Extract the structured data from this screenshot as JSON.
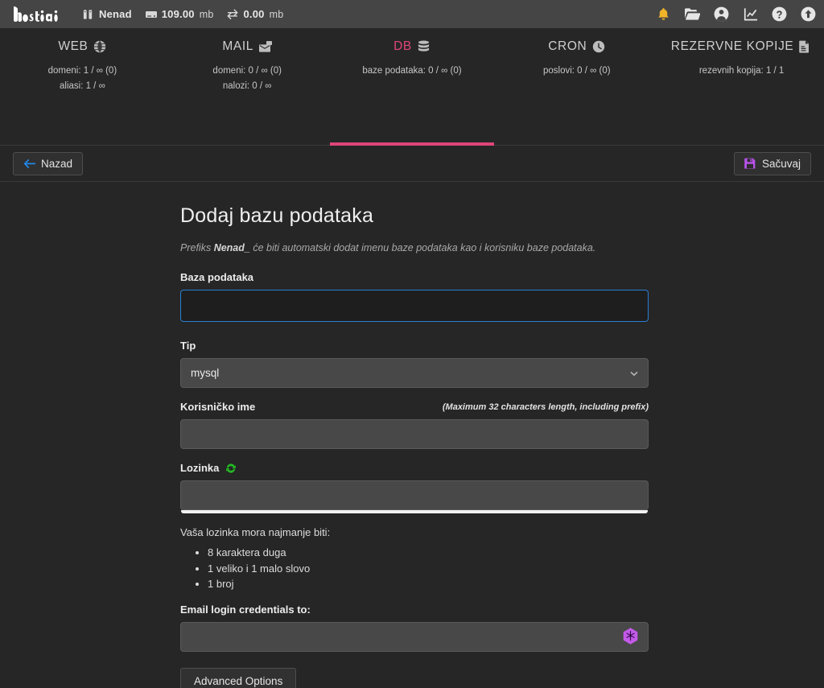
{
  "topbar": {
    "logo_text": "hestia",
    "user": "Nenad",
    "user_icon": "server-rack-icon",
    "disk_value": "109.00",
    "disk_unit": "mb",
    "disk_icon": "hdd-icon",
    "bandwidth_value": "0.00",
    "bandwidth_unit": "mb",
    "bandwidth_icon": "transfer-arrows-icon",
    "right_icons": [
      {
        "name": "notifications-bell-icon",
        "glyph": "bell"
      },
      {
        "name": "files-folder-icon",
        "glyph": "folder"
      },
      {
        "name": "user-account-icon",
        "glyph": "user"
      },
      {
        "name": "statistics-chart-icon",
        "glyph": "chart"
      },
      {
        "name": "help-question-icon",
        "glyph": "help"
      },
      {
        "name": "updates-upload-icon",
        "glyph": "upload"
      }
    ]
  },
  "nav": {
    "active_index": 2,
    "accent": "#e0457b",
    "items": [
      {
        "title": "WEB",
        "icon": "globe-icon",
        "lines": [
          "domeni: 1 / ∞ (0)",
          "aliasi: 1 / ∞"
        ]
      },
      {
        "title": "MAIL",
        "icon": "mail-stack-icon",
        "lines": [
          "domeni: 0 / ∞ (0)",
          "nalozi: 0 / ∞"
        ]
      },
      {
        "title": "DB",
        "icon": "database-icon",
        "lines": [
          "baze podataka: 0 / ∞ (0)"
        ]
      },
      {
        "title": "CRON",
        "icon": "clock-icon",
        "lines": [
          "poslovi: 0 / ∞ (0)"
        ]
      },
      {
        "title": "REZERVNE KOPIJE",
        "icon": "backup-file-icon",
        "lines": [
          "rezevnih kopija: 1 / 1"
        ]
      }
    ]
  },
  "toolbar": {
    "back_label": "Nazad",
    "back_icon": "arrow-left-icon",
    "save_label": "Sačuvaj",
    "save_icon": "floppy-save-icon"
  },
  "main": {
    "page_title": "Dodaj bazu podataka",
    "prefix_note_before": "Prefiks ",
    "prefix_note_bold": "Nenad_",
    "prefix_note_after": " će biti automatski dodat imenu baze podataka kao i korisniku baze podataka.",
    "fields": {
      "database": {
        "label": "Baza podataka",
        "value": "",
        "placeholder": ""
      },
      "type": {
        "label": "Tip",
        "value": "mysql",
        "options": [
          "mysql"
        ],
        "chevron_icon": "chevron-down-icon"
      },
      "username": {
        "label": "Korisničko ime",
        "hint": "(Maximum 32 characters length, including prefix)",
        "value": "",
        "placeholder": ""
      },
      "password": {
        "label": "Lozinka",
        "generate_icon": "refresh-generate-icon",
        "value": "",
        "placeholder": ""
      },
      "email": {
        "label": "Email login credentials to:",
        "value": "",
        "placeholder": "",
        "extension_icon": "password-manager-hex-icon"
      }
    },
    "password_requirements": {
      "title": "Vaša lozinka mora najmanje biti:",
      "items": [
        "8 karaktera duga",
        "1 veliko i 1 malo slovo",
        "1 broj"
      ]
    },
    "advanced_options_label": "Advanced Options"
  }
}
